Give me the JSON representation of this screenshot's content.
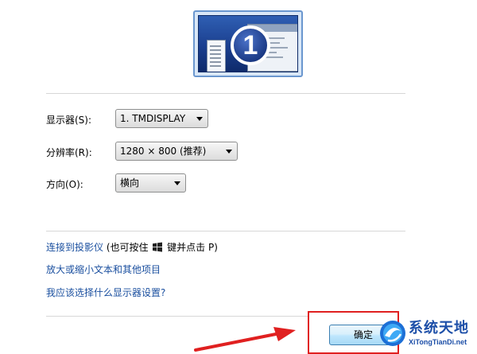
{
  "display_settings": {
    "monitor_number": "1",
    "fields": {
      "display": {
        "label": "显示器(S):",
        "value": "1. TMDISPLAY"
      },
      "resolution": {
        "label": "分辨率(R):",
        "value": "1280 × 800 (推荐)"
      },
      "orientation": {
        "label": "方向(O):",
        "value": "横向"
      }
    },
    "links": {
      "projector": {
        "link_text": "连接到投影仪",
        "suffix_before_icon": " (也可按住 ",
        "suffix_after_icon": " 键并点击 P)"
      },
      "text_size": "放大或缩小文本和其他项目",
      "which_settings": "我应该选择什么显示器设置?"
    },
    "ok_button": "确定"
  },
  "watermark": {
    "title": "系统天地",
    "url": "XiTongTianDi.net"
  },
  "colors": {
    "link": "#1a4f9f",
    "highlight_box": "#e02020",
    "arrow": "#e02020"
  }
}
